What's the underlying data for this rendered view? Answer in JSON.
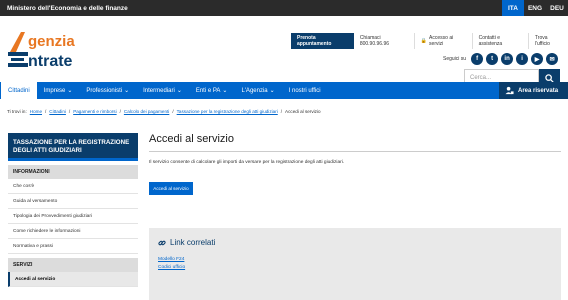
{
  "topbar": {
    "ministry": "Ministero dell'Economia e delle finanze",
    "languages": [
      "ITA",
      "ENG",
      "DEU"
    ]
  },
  "header": {
    "logo_top": "genzia",
    "logo_bottom": "ntrate",
    "prenota": "Prenota appuntamento",
    "chiamaci": "Chiamaci 800.90.96.96",
    "accesso": "Accesso ai servizi",
    "contatti": "Contatti e assistenza",
    "trova": "Trova l'ufficio",
    "seguici": "Seguici su",
    "social": [
      "f",
      "t",
      "in",
      "i",
      "▶",
      "✉"
    ],
    "search_placeholder": "Cerca..."
  },
  "nav": {
    "items": [
      "Cittadini",
      "Imprese",
      "Professionisti",
      "Intermediari",
      "Enti e PA",
      "L'Agenzia",
      "I nostri uffici"
    ],
    "area_riservata": "Area riservata"
  },
  "breadcrumb": {
    "prefix": "Ti trovi in:",
    "links": [
      "Home",
      "Cittadini",
      "Pagamenti e rimborsi",
      "Calcolo dei pagamenti",
      "Tassazione per la registrazione degli atti giudiziari"
    ],
    "current": "Accedi al servizio"
  },
  "sidebar": {
    "title": "TASSAZIONE PER LA REGISTRAZIONE DEGLI ATTI GIUDIZIARI",
    "informazioni": "INFORMAZIONI",
    "info_items": [
      "Che cos'è",
      "Guida al versamento",
      "Tipologia dei Provvedimenti giudiziari",
      "Come richiedere le informazioni",
      "Normativa e prassi"
    ],
    "servizi": "SERVIZI",
    "servizi_items": [
      "Accedi al servizio"
    ]
  },
  "main": {
    "title": "Accedi al servizio",
    "text": "Il servizio consente di calcolare gli importi da versare per la registrazione degli atti giudiziari.",
    "button": "Accedi al servizio",
    "related_title": "Link correlati",
    "related_links": [
      "Modello F24",
      "Codici ufficio"
    ]
  },
  "colors": {
    "navy": "#0a3d6b",
    "blue": "#0066cc",
    "orange": "#e87722"
  }
}
